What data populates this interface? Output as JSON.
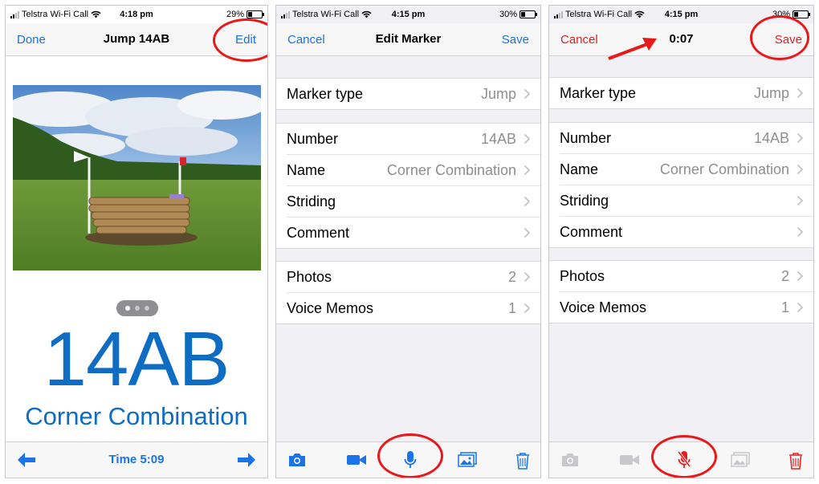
{
  "status_bars": [
    {
      "carrier": "Telstra Wi-Fi Call",
      "time": "4:18 pm",
      "battery": "29%"
    },
    {
      "carrier": "Telstra Wi-Fi Call",
      "time": "4:15 pm",
      "battery": "30%"
    },
    {
      "carrier": "Telstra Wi-Fi Call",
      "time": "4:15 pm",
      "battery": "30%"
    }
  ],
  "screen1": {
    "nav": {
      "left": "Done",
      "title": "Jump 14AB",
      "right": "Edit"
    },
    "marker_number": "14AB",
    "marker_name": "Corner Combination",
    "time_label": "Time 5:09",
    "page_dots": {
      "count": 3,
      "active": 0
    }
  },
  "screen2": {
    "nav": {
      "left": "Cancel",
      "title": "Edit Marker",
      "right": "Save"
    },
    "rows": {
      "marker_type": {
        "label": "Marker type",
        "value": "Jump"
      },
      "number": {
        "label": "Number",
        "value": "14AB"
      },
      "name": {
        "label": "Name",
        "value": "Corner Combination"
      },
      "striding": {
        "label": "Striding",
        "value": ""
      },
      "comment": {
        "label": "Comment",
        "value": ""
      },
      "photos": {
        "label": "Photos",
        "value": "2"
      },
      "voice_memos": {
        "label": "Voice Memos",
        "value": "1"
      }
    }
  },
  "screen3": {
    "nav": {
      "left": "Cancel",
      "timer": "0:07",
      "right": "Save"
    },
    "rows": {
      "marker_type": {
        "label": "Marker type",
        "value": "Jump"
      },
      "number": {
        "label": "Number",
        "value": "14AB"
      },
      "name": {
        "label": "Name",
        "value": "Corner Combination"
      },
      "striding": {
        "label": "Striding",
        "value": ""
      },
      "comment": {
        "label": "Comment",
        "value": ""
      },
      "photos": {
        "label": "Photos",
        "value": "2"
      },
      "voice_memos": {
        "label": "Voice Memos",
        "value": "1"
      }
    }
  },
  "colors": {
    "accent": "#1a73e8",
    "big_text": "#0f6cc3",
    "destructive": "#e0211f",
    "highlight_circle": "#e8191a"
  },
  "icons": [
    "wifi-icon",
    "battery-icon",
    "left-arrow-icon",
    "right-arrow-icon",
    "chevron-right-icon",
    "camera-icon",
    "video-icon",
    "microphone-icon",
    "microphone-off-icon",
    "photo-library-icon",
    "trash-icon"
  ]
}
